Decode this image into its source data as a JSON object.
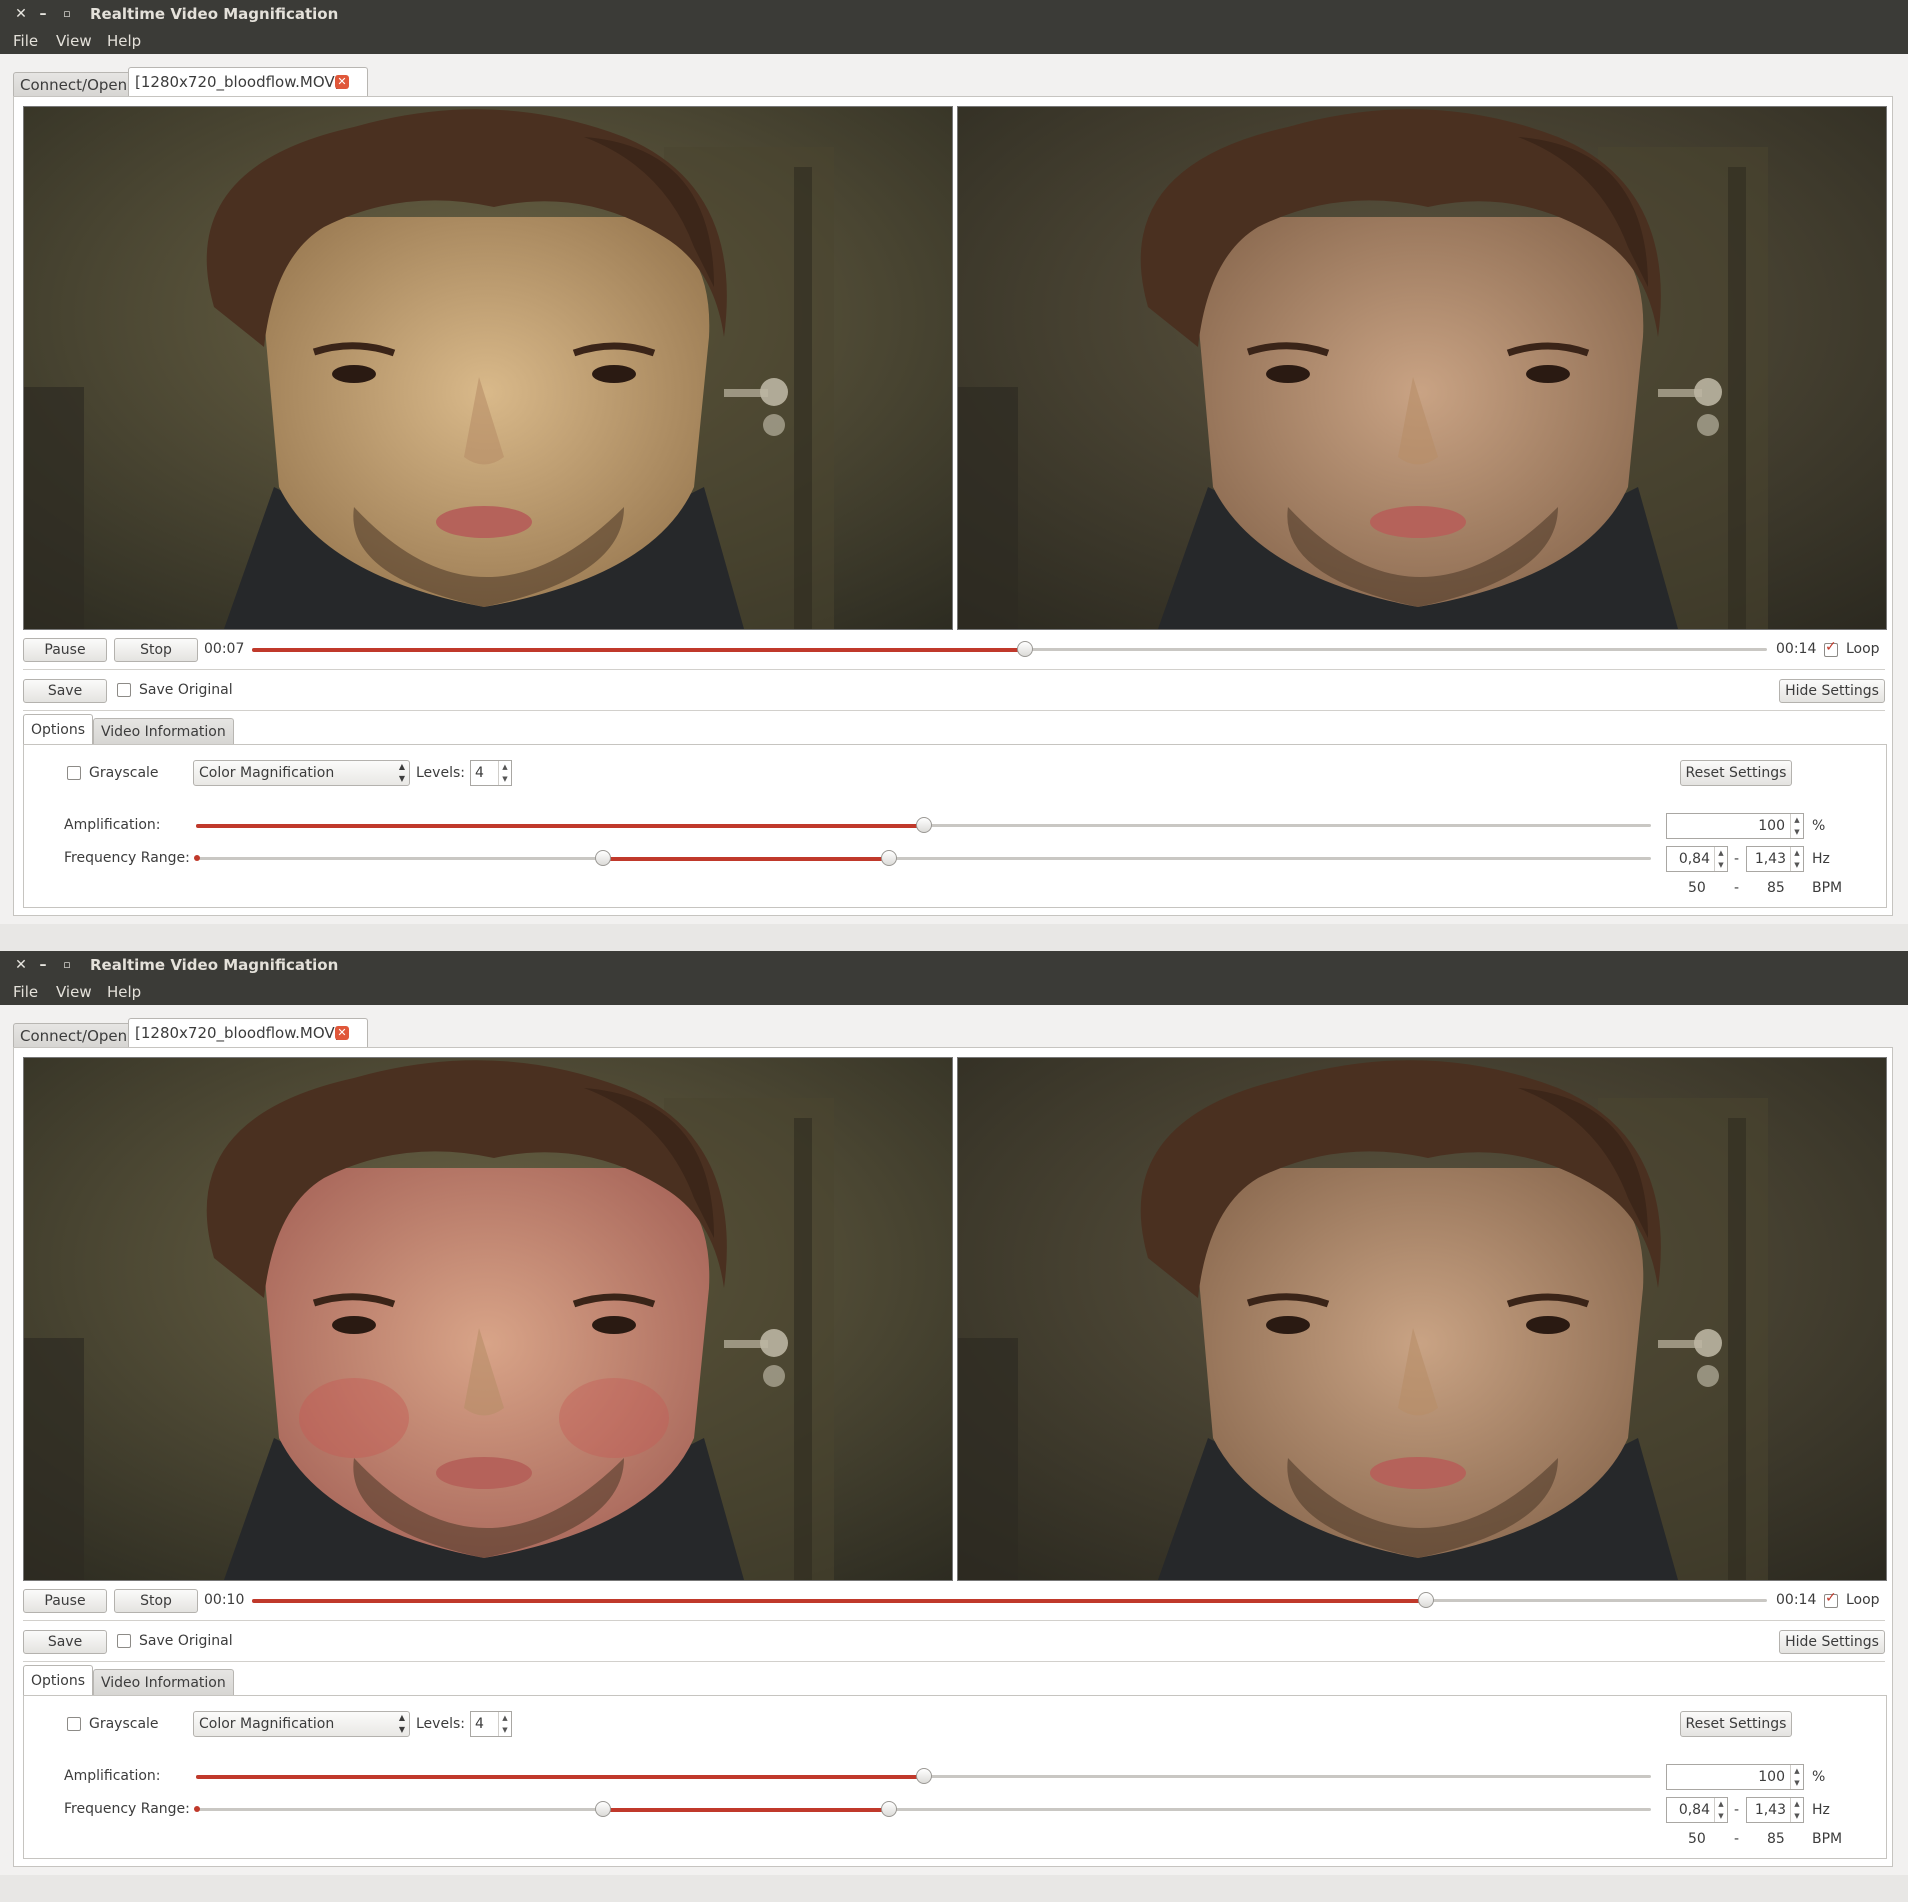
{
  "windows": [
    {
      "title": "Realtime Video Magnification",
      "menu": [
        "File",
        "View",
        "Help"
      ],
      "tabs": {
        "connect": "Connect/Open",
        "file": "[1280x720_bloodflow.MOV]"
      },
      "controls": {
        "pause": "Pause",
        "stop": "Stop",
        "current_time": "00:07",
        "total_time": "00:14",
        "progress": 0.51,
        "loop": "Loop",
        "loop_checked": true
      },
      "save": {
        "save": "Save",
        "save_original": "Save Original",
        "hide_settings": "Hide Settings"
      },
      "options": {
        "tab_options": "Options",
        "tab_video_info": "Video Information",
        "grayscale": "Grayscale",
        "mode": "Color Magnification",
        "levels_label": "Levels:",
        "levels": "4",
        "reset": "Reset Settings",
        "amplification_label": "Amplification:",
        "amplification": "100",
        "amplification_unit": "%",
        "amplification_level": 0.5,
        "frequency_label": "Frequency Range:",
        "freq_low": "0,84",
        "freq_dash": "-",
        "freq_high": "1,43",
        "freq_unit": "Hz",
        "freq_low_level": 0.28,
        "freq_high_level": 0.476,
        "bpm_low": "50",
        "bpm_dash": "-",
        "bpm_high": "85",
        "bpm_unit": "BPM"
      }
    },
    {
      "title": "Realtime Video Magnification",
      "menu": [
        "File",
        "View",
        "Help"
      ],
      "tabs": {
        "connect": "Connect/Open",
        "file": "[1280x720_bloodflow.MOV]"
      },
      "controls": {
        "pause": "Pause",
        "stop": "Stop",
        "current_time": "00:10",
        "total_time": "00:14",
        "progress": 0.775,
        "loop": "Loop",
        "loop_checked": true
      },
      "save": {
        "save": "Save",
        "save_original": "Save Original",
        "hide_settings": "Hide Settings"
      },
      "options": {
        "tab_options": "Options",
        "tab_video_info": "Video Information",
        "grayscale": "Grayscale",
        "mode": "Color Magnification",
        "levels_label": "Levels:",
        "levels": "4",
        "reset": "Reset Settings",
        "amplification_label": "Amplification:",
        "amplification": "100",
        "amplification_unit": "%",
        "amplification_level": 0.5,
        "frequency_label": "Frequency Range:",
        "freq_low": "0,84",
        "freq_dash": "-",
        "freq_high": "1,43",
        "freq_unit": "Hz",
        "freq_low_level": 0.28,
        "freq_high_level": 0.476,
        "bpm_low": "50",
        "bpm_dash": "-",
        "bpm_high": "85",
        "bpm_unit": "BPM"
      }
    }
  ],
  "icons": {
    "close": "close-icon",
    "minimize": "minimize-icon",
    "maximize": "maximize-icon",
    "tab_close": "tab-close-icon",
    "check": "checkmark-icon"
  },
  "colors": {
    "accent": "#c0392b",
    "titlebar": "#3b3b37",
    "tab_close": "#e0573a"
  }
}
